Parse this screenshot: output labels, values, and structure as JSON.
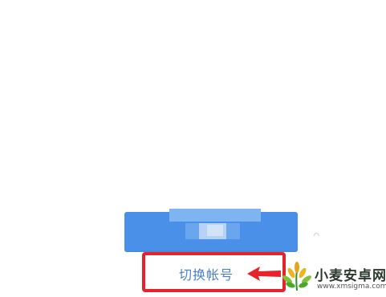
{
  "login": {
    "primary_button_label": "",
    "switch_account_label": "切换帐号"
  },
  "watermark": {
    "title": "小麦安卓网",
    "url": "www.xmsigma.com"
  },
  "annotation": {
    "box_color": "#e8222a",
    "arrow_color": "#e8222a"
  },
  "colors": {
    "button_blue": "#4a90e8",
    "link_blue": "#4a7fc8",
    "background": "#ffffff"
  },
  "icons": {
    "arrow": "arrow-left-icon",
    "logo": "wheat-logo-icon"
  }
}
